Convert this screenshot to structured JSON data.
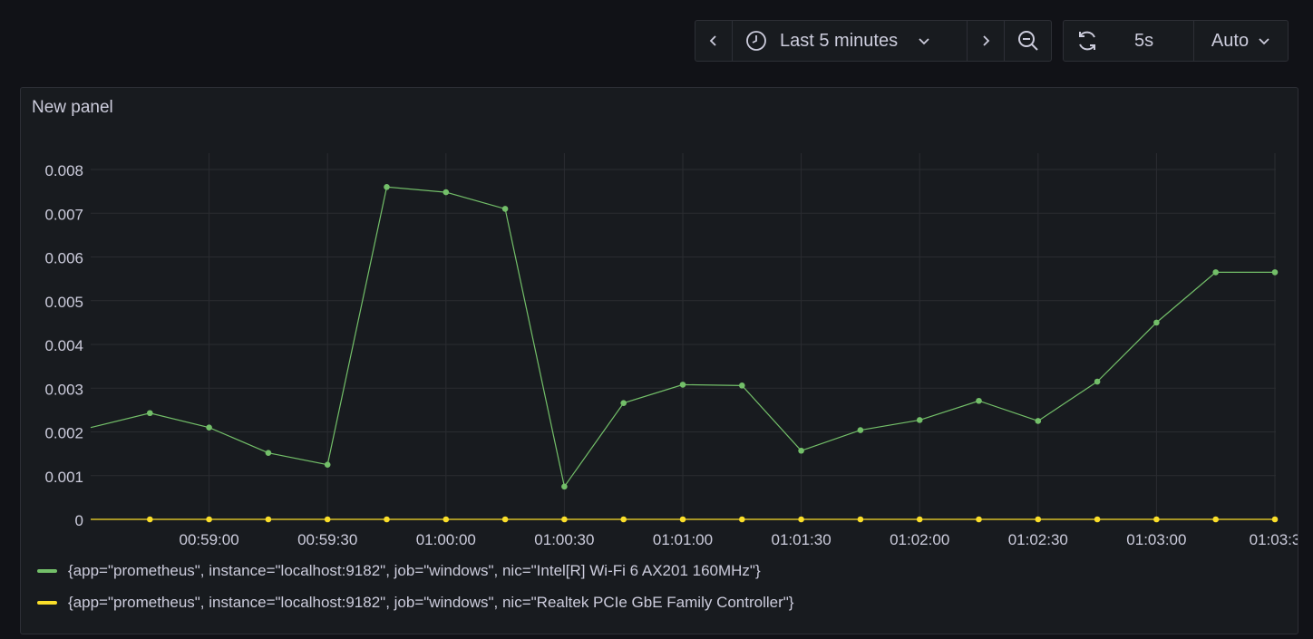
{
  "toolbar": {
    "time_range_label": "Last 5 minutes",
    "refresh_interval": "5s",
    "auto_label": "Auto"
  },
  "panel": {
    "title": "New panel"
  },
  "chart_data": {
    "type": "line",
    "ylim": [
      0,
      0.008
    ],
    "y_ticks": [
      "0",
      "0.001",
      "0.002",
      "0.003",
      "0.004",
      "0.005",
      "0.006",
      "0.007",
      "0.008"
    ],
    "x_ticks": [
      "00:59:00",
      "00:59:30",
      "01:00:00",
      "01:00:30",
      "01:01:00",
      "01:01:30",
      "01:02:00",
      "01:02:30",
      "01:03:00",
      "01:03:3"
    ],
    "grid": true,
    "legend_position": "bottom",
    "series": [
      {
        "name": "{app=\"prometheus\", instance=\"localhost:9182\", job=\"windows\", nic=\"Intel[R] Wi-Fi 6 AX201 160MHz\"}",
        "color": "#73bf69",
        "values": [
          0.0021,
          0.00243,
          0.0021,
          0.00152,
          0.00125,
          0.0076,
          0.00748,
          0.0071,
          0.00075,
          0.00266,
          0.00308,
          0.00306,
          0.00157,
          0.00204,
          0.00227,
          0.00271,
          0.00225,
          0.00315,
          0.0045,
          0.00565,
          0.00565
        ]
      },
      {
        "name": "{app=\"prometheus\", instance=\"localhost:9182\", job=\"windows\", nic=\"Realtek PCIe GbE Family Controller\"}",
        "color": "#fade2a",
        "values": [
          0,
          0,
          0,
          0,
          0,
          0,
          0,
          0,
          0,
          0,
          0,
          0,
          0,
          0,
          0,
          0,
          0,
          0,
          0,
          0,
          0
        ]
      }
    ]
  }
}
